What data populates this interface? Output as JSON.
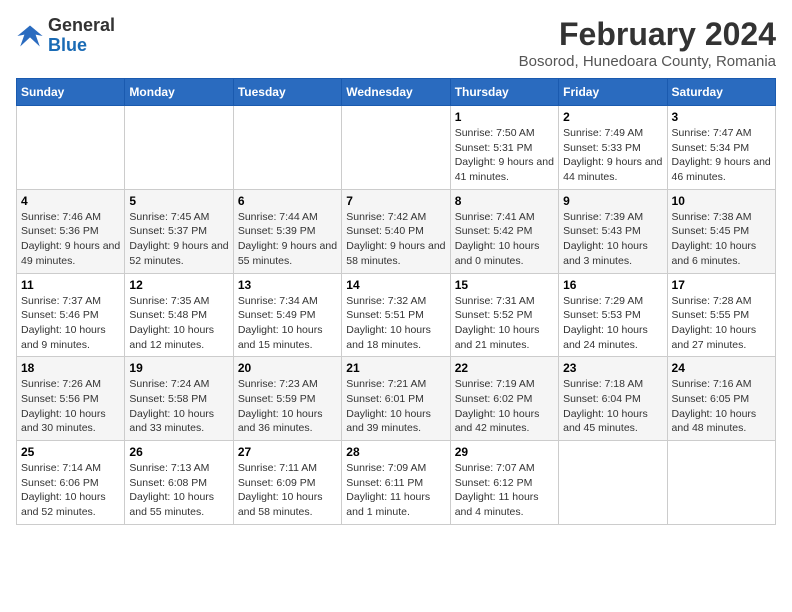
{
  "header": {
    "title": "February 2024",
    "subtitle": "Bosorod, Hunedoara County, Romania",
    "logo_general": "General",
    "logo_blue": "Blue"
  },
  "days_of_week": [
    "Sunday",
    "Monday",
    "Tuesday",
    "Wednesday",
    "Thursday",
    "Friday",
    "Saturday"
  ],
  "weeks": [
    [
      {
        "day": "",
        "info": ""
      },
      {
        "day": "",
        "info": ""
      },
      {
        "day": "",
        "info": ""
      },
      {
        "day": "",
        "info": ""
      },
      {
        "day": "1",
        "info": "Sunrise: 7:50 AM\nSunset: 5:31 PM\nDaylight: 9 hours and 41 minutes."
      },
      {
        "day": "2",
        "info": "Sunrise: 7:49 AM\nSunset: 5:33 PM\nDaylight: 9 hours and 44 minutes."
      },
      {
        "day": "3",
        "info": "Sunrise: 7:47 AM\nSunset: 5:34 PM\nDaylight: 9 hours and 46 minutes."
      }
    ],
    [
      {
        "day": "4",
        "info": "Sunrise: 7:46 AM\nSunset: 5:36 PM\nDaylight: 9 hours and 49 minutes."
      },
      {
        "day": "5",
        "info": "Sunrise: 7:45 AM\nSunset: 5:37 PM\nDaylight: 9 hours and 52 minutes."
      },
      {
        "day": "6",
        "info": "Sunrise: 7:44 AM\nSunset: 5:39 PM\nDaylight: 9 hours and 55 minutes."
      },
      {
        "day": "7",
        "info": "Sunrise: 7:42 AM\nSunset: 5:40 PM\nDaylight: 9 hours and 58 minutes."
      },
      {
        "day": "8",
        "info": "Sunrise: 7:41 AM\nSunset: 5:42 PM\nDaylight: 10 hours and 0 minutes."
      },
      {
        "day": "9",
        "info": "Sunrise: 7:39 AM\nSunset: 5:43 PM\nDaylight: 10 hours and 3 minutes."
      },
      {
        "day": "10",
        "info": "Sunrise: 7:38 AM\nSunset: 5:45 PM\nDaylight: 10 hours and 6 minutes."
      }
    ],
    [
      {
        "day": "11",
        "info": "Sunrise: 7:37 AM\nSunset: 5:46 PM\nDaylight: 10 hours and 9 minutes."
      },
      {
        "day": "12",
        "info": "Sunrise: 7:35 AM\nSunset: 5:48 PM\nDaylight: 10 hours and 12 minutes."
      },
      {
        "day": "13",
        "info": "Sunrise: 7:34 AM\nSunset: 5:49 PM\nDaylight: 10 hours and 15 minutes."
      },
      {
        "day": "14",
        "info": "Sunrise: 7:32 AM\nSunset: 5:51 PM\nDaylight: 10 hours and 18 minutes."
      },
      {
        "day": "15",
        "info": "Sunrise: 7:31 AM\nSunset: 5:52 PM\nDaylight: 10 hours and 21 minutes."
      },
      {
        "day": "16",
        "info": "Sunrise: 7:29 AM\nSunset: 5:53 PM\nDaylight: 10 hours and 24 minutes."
      },
      {
        "day": "17",
        "info": "Sunrise: 7:28 AM\nSunset: 5:55 PM\nDaylight: 10 hours and 27 minutes."
      }
    ],
    [
      {
        "day": "18",
        "info": "Sunrise: 7:26 AM\nSunset: 5:56 PM\nDaylight: 10 hours and 30 minutes."
      },
      {
        "day": "19",
        "info": "Sunrise: 7:24 AM\nSunset: 5:58 PM\nDaylight: 10 hours and 33 minutes."
      },
      {
        "day": "20",
        "info": "Sunrise: 7:23 AM\nSunset: 5:59 PM\nDaylight: 10 hours and 36 minutes."
      },
      {
        "day": "21",
        "info": "Sunrise: 7:21 AM\nSunset: 6:01 PM\nDaylight: 10 hours and 39 minutes."
      },
      {
        "day": "22",
        "info": "Sunrise: 7:19 AM\nSunset: 6:02 PM\nDaylight: 10 hours and 42 minutes."
      },
      {
        "day": "23",
        "info": "Sunrise: 7:18 AM\nSunset: 6:04 PM\nDaylight: 10 hours and 45 minutes."
      },
      {
        "day": "24",
        "info": "Sunrise: 7:16 AM\nSunset: 6:05 PM\nDaylight: 10 hours and 48 minutes."
      }
    ],
    [
      {
        "day": "25",
        "info": "Sunrise: 7:14 AM\nSunset: 6:06 PM\nDaylight: 10 hours and 52 minutes."
      },
      {
        "day": "26",
        "info": "Sunrise: 7:13 AM\nSunset: 6:08 PM\nDaylight: 10 hours and 55 minutes."
      },
      {
        "day": "27",
        "info": "Sunrise: 7:11 AM\nSunset: 6:09 PM\nDaylight: 10 hours and 58 minutes."
      },
      {
        "day": "28",
        "info": "Sunrise: 7:09 AM\nSunset: 6:11 PM\nDaylight: 11 hours and 1 minute."
      },
      {
        "day": "29",
        "info": "Sunrise: 7:07 AM\nSunset: 6:12 PM\nDaylight: 11 hours and 4 minutes."
      },
      {
        "day": "",
        "info": ""
      },
      {
        "day": "",
        "info": ""
      }
    ]
  ]
}
